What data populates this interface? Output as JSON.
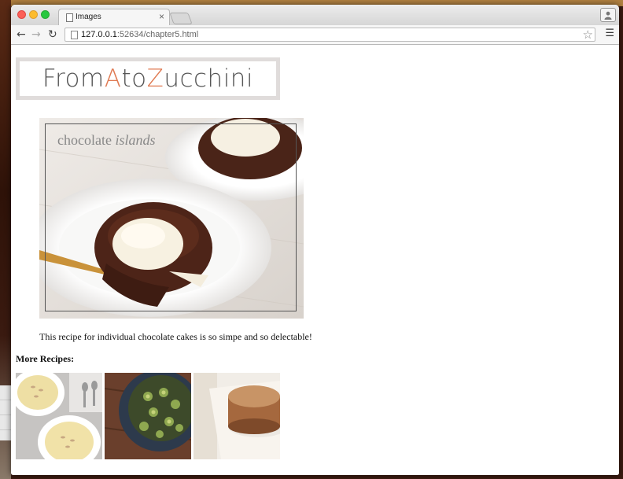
{
  "browser": {
    "tab_title": "Images",
    "tab_close": "×",
    "url_host": "127.0.0.1",
    "url_rest": ":52634/chapter5.html"
  },
  "page": {
    "banner": {
      "part1": "From ",
      "accent1": "A",
      "part2": " to ",
      "accent2": "Z",
      "part3": "ucchini"
    },
    "hero": {
      "caption_plain": "chocolate ",
      "caption_italic": "islands"
    },
    "description": "This recipe for individual chocolate cakes is so simpe and so delectable!",
    "more_heading": "More Recipes:"
  },
  "colors": {
    "accent": "#e07b53",
    "banner_border": "#e0dcdb"
  }
}
